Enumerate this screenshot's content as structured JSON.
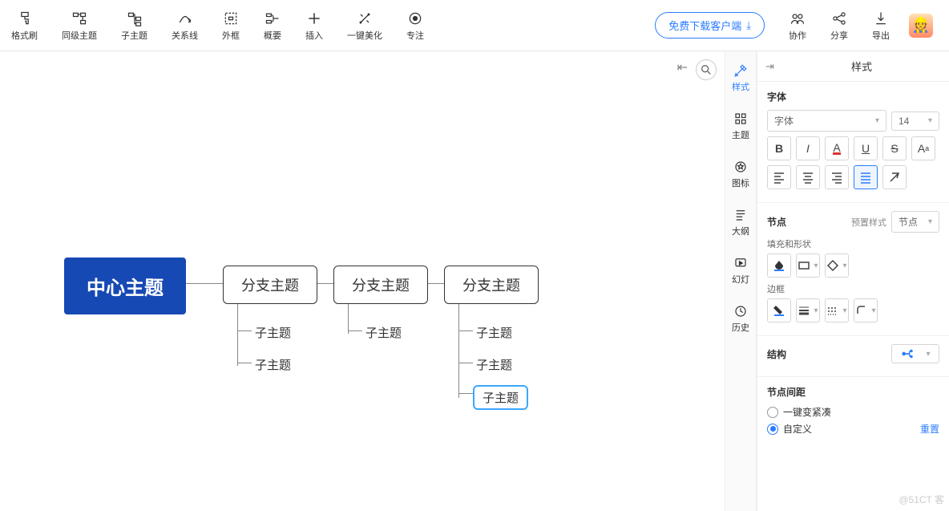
{
  "toolbar": {
    "items": [
      {
        "key": "format-painter",
        "label": "格式刷"
      },
      {
        "key": "sibling-topic",
        "label": "同级主题"
      },
      {
        "key": "sub-topic",
        "label": "子主题"
      },
      {
        "key": "relation",
        "label": "关系线"
      },
      {
        "key": "frame",
        "label": "外框"
      },
      {
        "key": "summary",
        "label": "概要"
      },
      {
        "key": "insert",
        "label": "插入"
      },
      {
        "key": "beautify",
        "label": "一键美化"
      },
      {
        "key": "focus",
        "label": "专注"
      }
    ],
    "download": "免费下载客户端",
    "right": [
      {
        "key": "collab",
        "label": "协作"
      },
      {
        "key": "share",
        "label": "分享"
      },
      {
        "key": "export",
        "label": "导出"
      }
    ]
  },
  "canvas": {
    "central": "中心主题",
    "branch": "分支主题",
    "sub": "子主题"
  },
  "side_tabs": [
    {
      "key": "style",
      "label": "样式",
      "active": true
    },
    {
      "key": "theme",
      "label": "主题"
    },
    {
      "key": "icon",
      "label": "图标"
    },
    {
      "key": "outline",
      "label": "大纲"
    },
    {
      "key": "slides",
      "label": "幻灯"
    },
    {
      "key": "history",
      "label": "历史"
    }
  ],
  "panel": {
    "title": "样式",
    "font": {
      "label": "字体",
      "family_placeholder": "字体",
      "size": "14"
    },
    "node": {
      "label": "节点",
      "preset": "预置样式",
      "node_select": "节点",
      "fill_shape": "填充和形状",
      "border": "边框"
    },
    "structure": {
      "label": "结构"
    },
    "spacing": {
      "label": "节点间距",
      "compact": "一键变紧凑",
      "custom": "自定义",
      "reset": "重置"
    }
  },
  "footer_brand": "@51CT 客"
}
